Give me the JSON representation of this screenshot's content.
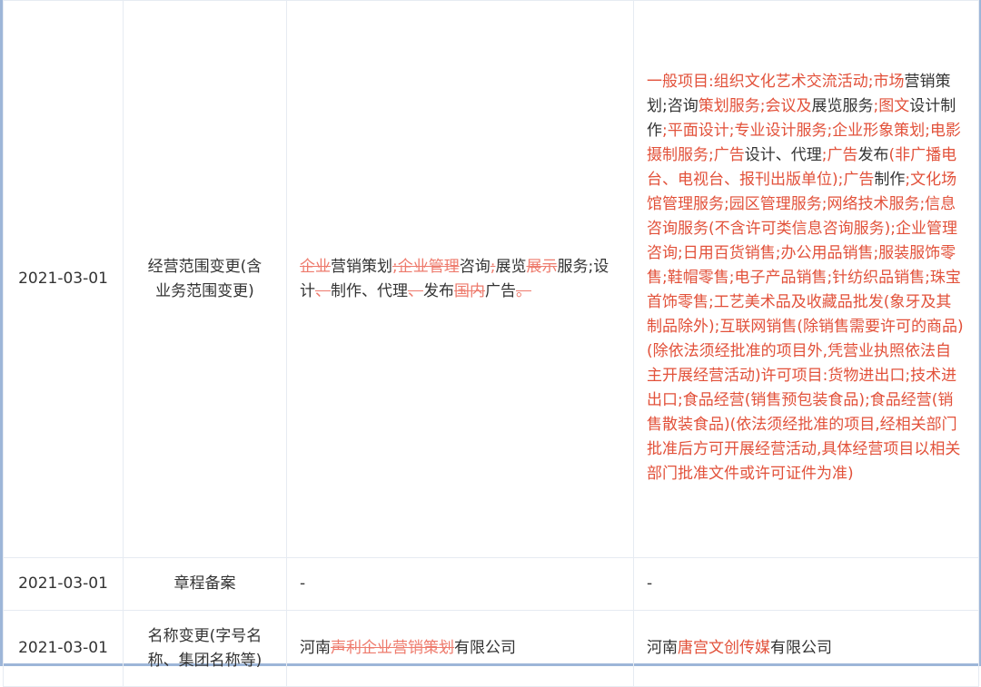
{
  "colors": {
    "deleted_text": "#ee7b6d",
    "added_text": "#e2513a",
    "normal_text": "#333333",
    "grid_border": "#e6ebf2",
    "frame_border": "#9db6d8"
  },
  "rows": [
    {
      "date": "2021-03-01",
      "item": "经营范围变更(含业务范围变更)",
      "before": [
        {
          "t": "企业",
          "s": "del"
        },
        {
          "t": "营销策划",
          "s": "txt"
        },
        {
          "t": ";企业管理",
          "s": "del"
        },
        {
          "t": "咨询",
          "s": "txt"
        },
        {
          "t": ";",
          "s": "del"
        },
        {
          "t": "展览",
          "s": "txt"
        },
        {
          "t": "展示",
          "s": "del"
        },
        {
          "t": "服务;设计",
          "s": "txt"
        },
        {
          "t": "、",
          "s": "del"
        },
        {
          "t": "制作、代理",
          "s": "txt"
        },
        {
          "t": "、",
          "s": "del"
        },
        {
          "t": "发布",
          "s": "txt"
        },
        {
          "t": "国内",
          "s": "del"
        },
        {
          "t": "广告",
          "s": "txt"
        },
        {
          "t": "。",
          "s": "del"
        }
      ],
      "after": [
        {
          "t": "一般项目:组织文化艺术交流活动;市场",
          "s": "add"
        },
        {
          "t": "营销策划",
          "s": "txt"
        },
        {
          "t": ";咨询",
          "s": "txt"
        },
        {
          "t": "策划服务;会议及",
          "s": "add"
        },
        {
          "t": "展览服务",
          "s": "txt"
        },
        {
          "t": ";图文",
          "s": "add"
        },
        {
          "t": "设计制作",
          "s": "txt"
        },
        {
          "t": ";平面设计;专业设计服务;企业形象策划;电影摄制服务;广告",
          "s": "add"
        },
        {
          "t": "设计、代理",
          "s": "txt"
        },
        {
          "t": ";广告",
          "s": "add"
        },
        {
          "t": "发布",
          "s": "txt"
        },
        {
          "t": "(非广播电台、电视台、报刊出版单位);广告",
          "s": "add"
        },
        {
          "t": "制作",
          "s": "txt"
        },
        {
          "t": ";文化场馆管理服务;园区管理服务;网络技术服务;信息咨询服务(不含许可类信息咨询服务);企业管理咨询;日用百货销售;办公用品销售;服装服饰零售;鞋帽零售;电子产品销售;针纺织品销售;珠宝首饰零售;工艺美术品及收藏品批发(象牙及其制品除外);互联网销售(除销售需要许可的商品)(除依法须经批准的项目外,凭营业执照依法自主开展经营活动)许可项目:货物进出口;技术进出口;食品经营(销售预包装食品);食品经营(销售散装食品)(依法须经批准的项目,经相关部门批准后方可开展经营活动,具体经营项目以相关部门批准文件或许可证件为准)",
          "s": "add"
        }
      ]
    },
    {
      "date": "2021-03-01",
      "item": "章程备案",
      "before": [
        {
          "t": "-",
          "s": "txt"
        }
      ],
      "after": [
        {
          "t": "-",
          "s": "txt"
        }
      ]
    },
    {
      "date": "2021-03-01",
      "item": "名称变更(字号名称、集团名称等)",
      "before": [
        {
          "t": "河南",
          "s": "txt"
        },
        {
          "t": "声利企业营销策划",
          "s": "del"
        },
        {
          "t": "有限公司",
          "s": "txt"
        }
      ],
      "after": [
        {
          "t": "河南",
          "s": "txt"
        },
        {
          "t": "唐宫文创传媒",
          "s": "add"
        },
        {
          "t": "有限公司",
          "s": "txt"
        }
      ]
    }
  ]
}
